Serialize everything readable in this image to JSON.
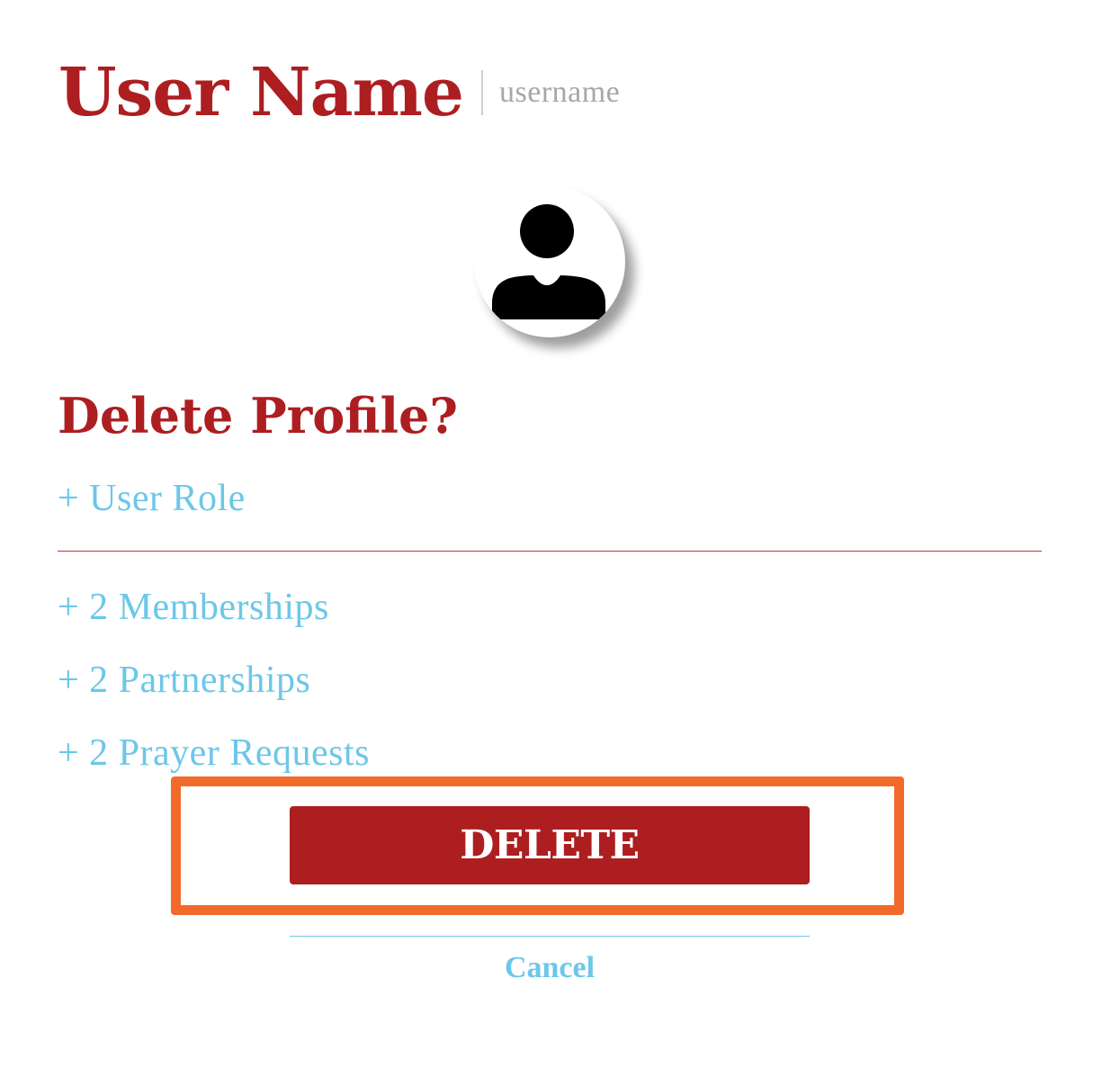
{
  "header": {
    "display_name": "User Name",
    "username": "username"
  },
  "avatar": {
    "icon": "user-silhouette-icon"
  },
  "dialog": {
    "title": "Delete Profile?",
    "related_items": [
      "+ User Role",
      "+ 2 Memberships",
      "+ 2 Partnerships",
      "+ 2 Prayer Requests"
    ],
    "delete_label": "DELETE",
    "cancel_label": "Cancel"
  },
  "colors": {
    "brand_red": "#ad1e21",
    "link_blue": "#6cc7e8",
    "highlight_orange": "#f26a2a"
  }
}
